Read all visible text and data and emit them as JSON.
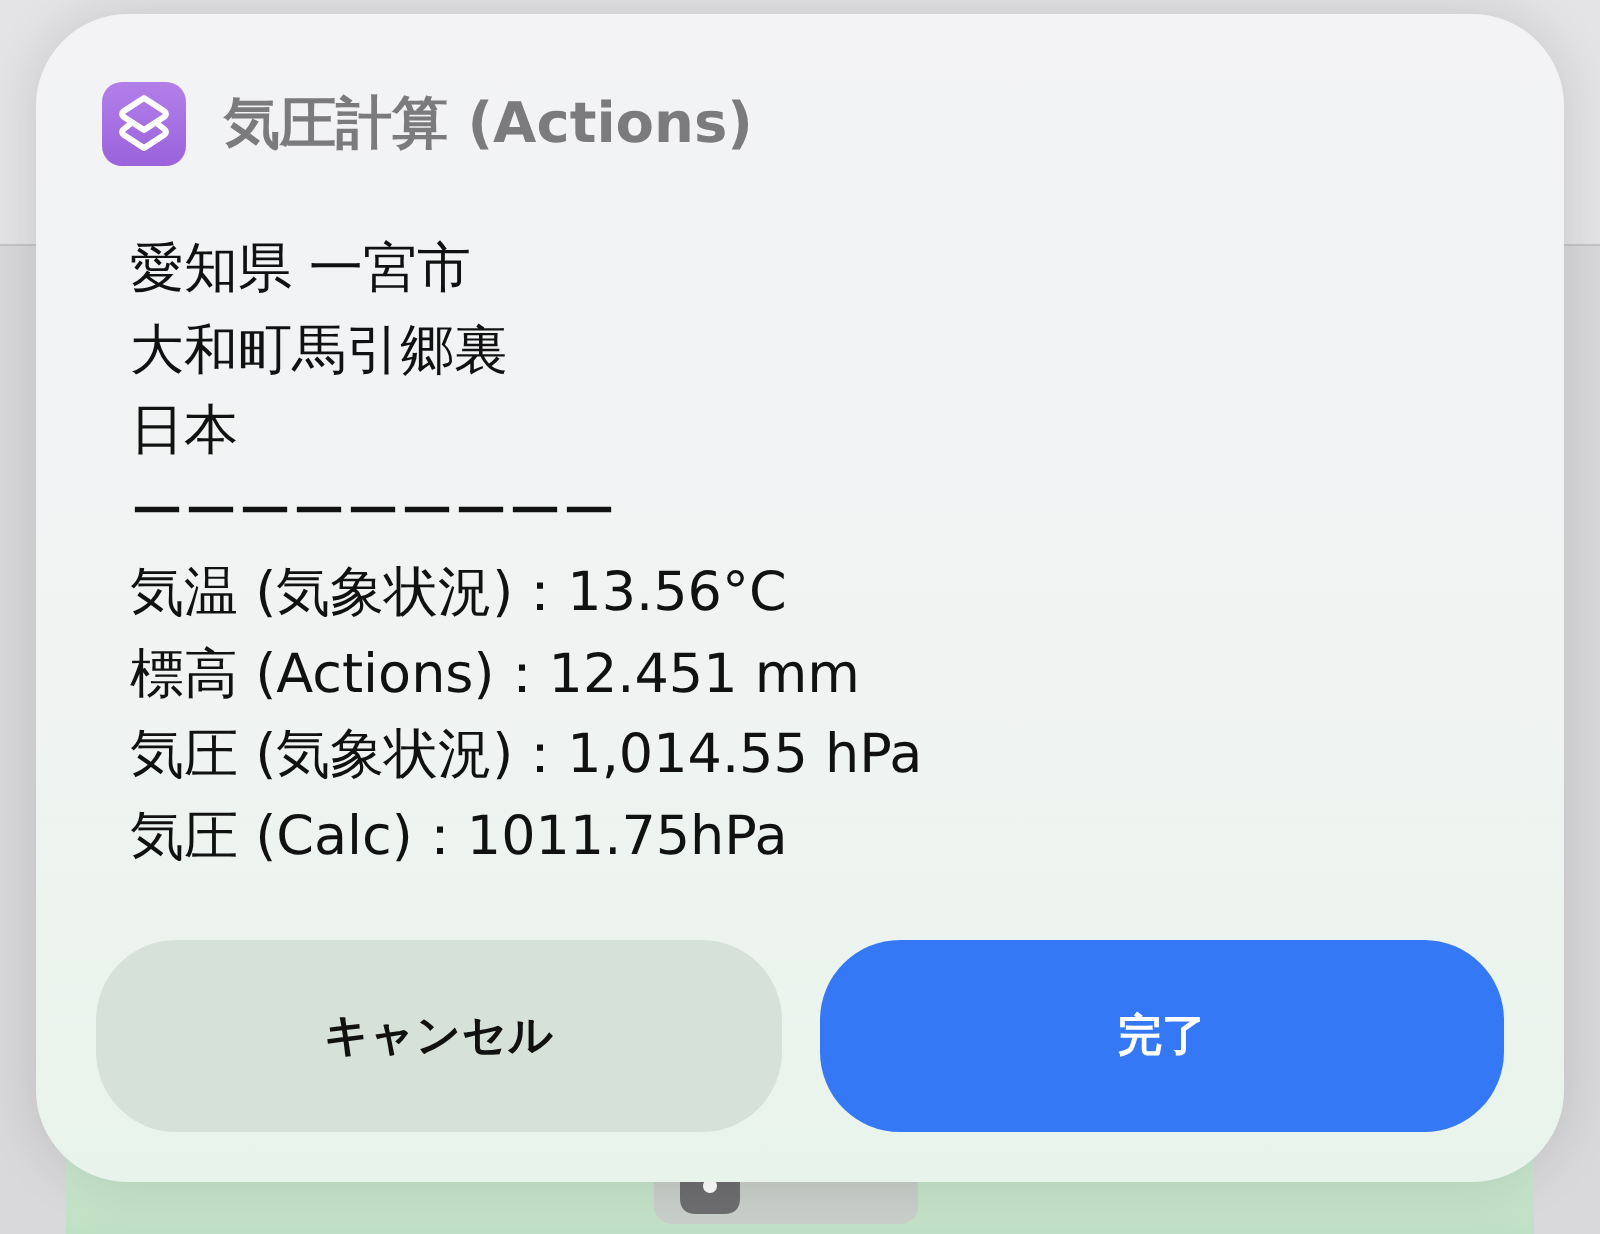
{
  "dialog": {
    "title": "気圧計算 (Actions)",
    "lines": [
      "愛知県 一宮市",
      "大和町馬引郷裏",
      "日本",
      "ーーーーーーーーー",
      "気温 (気象状況)：13.56°C",
      "標高 (Actions)：12.451 mm",
      "気圧 (気象状況)：1,014.55 hPa",
      "気圧 (Calc)：1011.75hPa"
    ]
  },
  "buttons": [
    {
      "kind": "secondary",
      "label": "キャンセル"
    },
    {
      "kind": "primary",
      "label": "完了"
    }
  ]
}
